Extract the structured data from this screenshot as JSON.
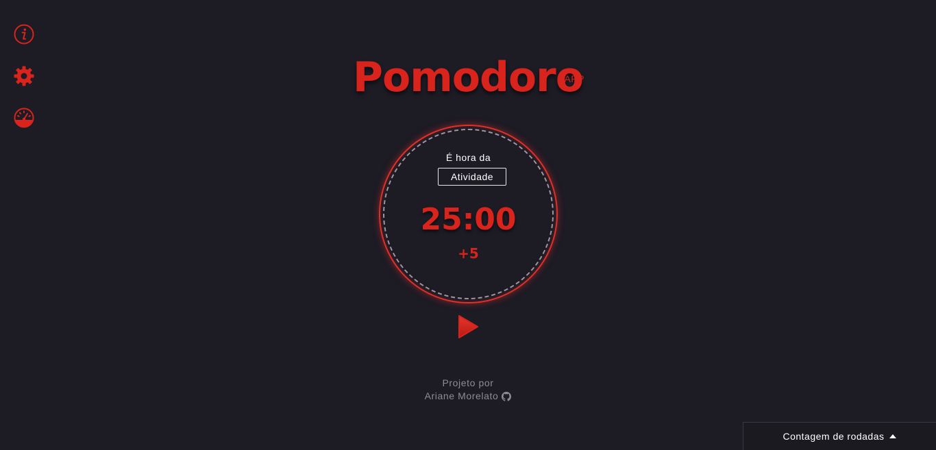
{
  "app": {
    "title": "Pomodoro",
    "title_sup": "APP",
    "accent_color": "#d8241d",
    "background_color": "#1d1b24"
  },
  "rail": [
    {
      "name": "info-icon"
    },
    {
      "name": "gear-icon"
    },
    {
      "name": "gauge-icon"
    }
  ],
  "timer": {
    "label": "É hora da",
    "mode": "Atividade",
    "time": "25:00",
    "add": "+5"
  },
  "controls": {
    "play_icon": "play-icon"
  },
  "credit": {
    "line1": "Projeto por",
    "author": "Ariane Morelato",
    "author_icon": "github-icon"
  },
  "rounds_panel": {
    "label": "Contagem de rodadas",
    "caret_icon": "caret-up-icon"
  }
}
